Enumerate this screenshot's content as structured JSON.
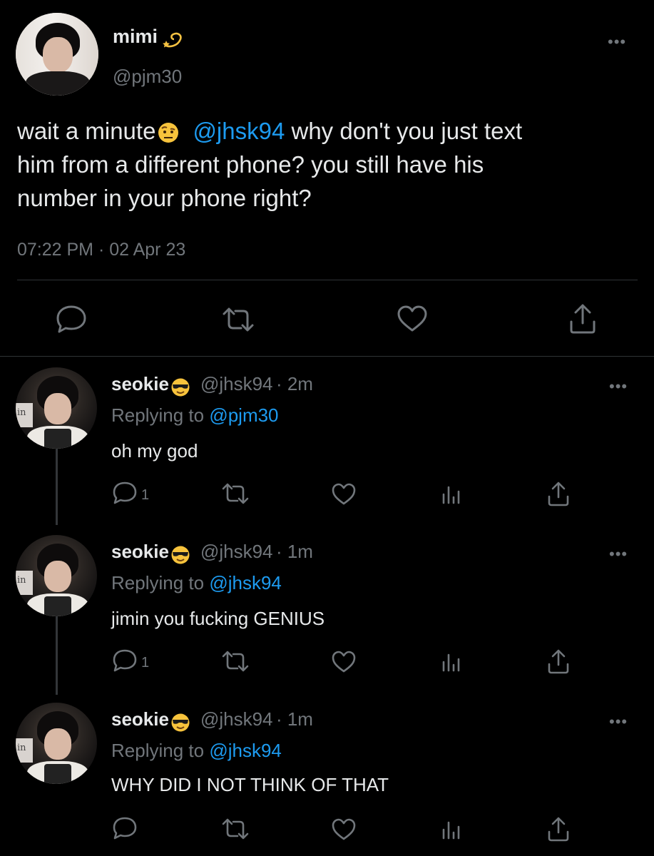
{
  "main_tweet": {
    "display_name": "mimi",
    "name_emoji": "dizzy-emoji",
    "handle": "@pjm30",
    "text_before": "wait a minute",
    "text_emoji": "raised-eyebrow-emoji",
    "mention": "@jhsk94",
    "text_after": " why don't you just text",
    "text_line2": "him from a different phone? you still have his",
    "text_line3": "number in your phone right?",
    "timestamp": "07:22 PM · 02 Apr 23",
    "actions": [
      "reply-icon",
      "retweet-icon",
      "like-icon",
      "share-icon"
    ]
  },
  "replies": [
    {
      "display_name": "seokie",
      "name_emoji": "sunglasses-emoji",
      "handle": "@jhsk94",
      "time": "· 2m",
      "replying_label": "Replying to ",
      "replying_to": "@pjm30",
      "text": "oh my god",
      "reply_count": "1"
    },
    {
      "display_name": "seokie",
      "name_emoji": "sunglasses-emoji",
      "handle": "@jhsk94",
      "time": "· 1m",
      "replying_label": "Replying to ",
      "replying_to": "@jhsk94",
      "text": "jimin you fucking GENIUS",
      "reply_count": "1"
    },
    {
      "display_name": "seokie",
      "name_emoji": "sunglasses-emoji",
      "handle": "@jhsk94",
      "time": "· 1m",
      "replying_label": "Replying to ",
      "replying_to": "@jhsk94",
      "text": "WHY DID I NOT THINK OF THAT",
      "reply_count": ""
    }
  ],
  "more_label": "•••",
  "avatar_sign_text": "in"
}
